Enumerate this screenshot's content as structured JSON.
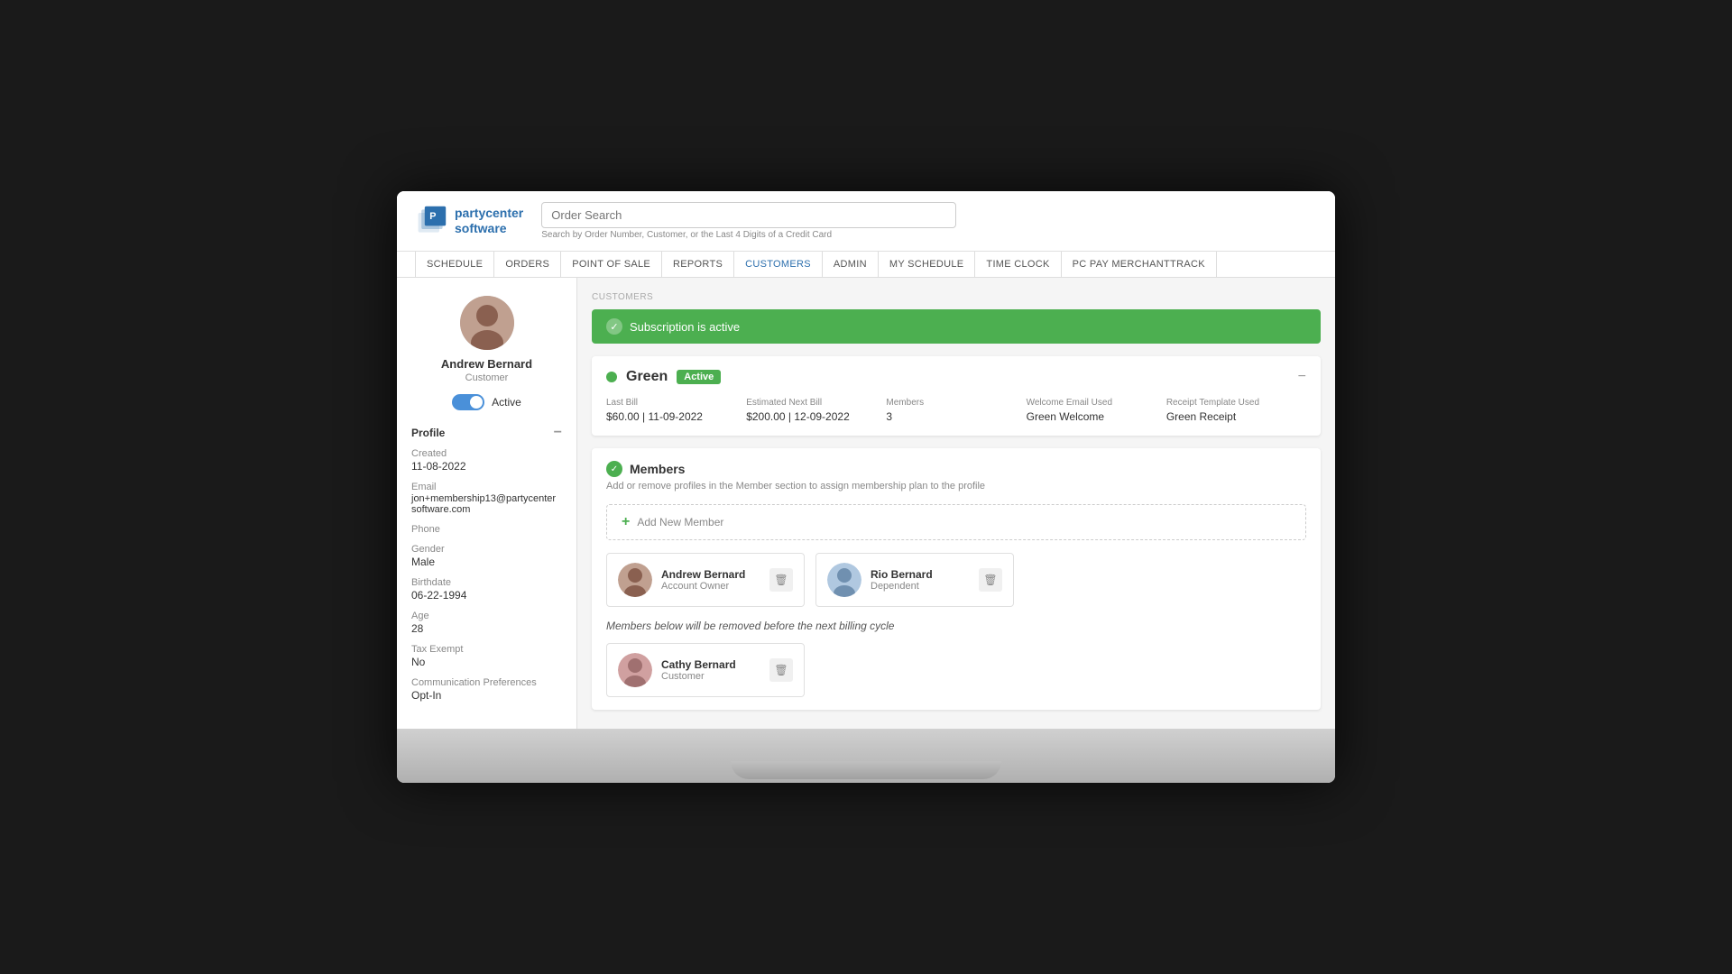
{
  "header": {
    "logo_line1": "partycenter",
    "logo_line2": "software",
    "search_placeholder": "Order Search",
    "search_hint": "Search by Order Number, Customer, or the Last 4 Digits of a Credit Card"
  },
  "nav": {
    "items": [
      {
        "label": "SCHEDULE",
        "active": false
      },
      {
        "label": "ORDERS",
        "active": false
      },
      {
        "label": "POINT OF SALE",
        "active": false
      },
      {
        "label": "REPORTS",
        "active": false
      },
      {
        "label": "CUSTOMERS",
        "active": true
      },
      {
        "label": "ADMIN",
        "active": false
      },
      {
        "label": "MY SCHEDULE",
        "active": false
      },
      {
        "label": "TIME CLOCK",
        "active": false
      },
      {
        "label": "PC PAY MERCHANTTRACK",
        "active": false
      }
    ]
  },
  "breadcrumb": "CUSTOMERS",
  "sidebar": {
    "user": {
      "name": "Andrew Bernard",
      "role": "Customer",
      "status": "Active"
    },
    "profile_section": "Profile",
    "fields": [
      {
        "label": "Created",
        "value": "11-08-2022"
      },
      {
        "label": "Email",
        "value": "jon+membership13@partycenter\nsoftware.com"
      },
      {
        "label": "Phone",
        "value": ""
      },
      {
        "label": "Gender",
        "value": "Male"
      },
      {
        "label": "Birthdate",
        "value": "06-22-1994"
      },
      {
        "label": "Age",
        "value": "28"
      },
      {
        "label": "Tax Exempt",
        "value": "No"
      },
      {
        "label": "Communication Preferences",
        "value": "Opt-In"
      }
    ]
  },
  "subscription_alert": "Subscription is active",
  "membership": {
    "name": "Green",
    "status": "Active",
    "stats": [
      {
        "label": "Last Bill",
        "value": "$60.00 | 11-09-2022"
      },
      {
        "label": "Estimated Next Bill",
        "value": "$200.00 | 12-09-2022"
      },
      {
        "label": "Members",
        "value": "3"
      },
      {
        "label": "Welcome Email Used",
        "value": "Green Welcome"
      },
      {
        "label": "Receipt Template Used",
        "value": "Green Receipt"
      }
    ]
  },
  "members_section": {
    "title": "Members",
    "hint": "Add or remove profiles in the Member section to assign membership plan to the profile",
    "add_button": "Add New Member",
    "members": [
      {
        "name": "Andrew Bernard",
        "type": "Account Owner"
      },
      {
        "name": "Rio Bernard",
        "type": "Dependent"
      }
    ],
    "removal_notice": "Members below will be removed before the next billing cycle",
    "removal_members": [
      {
        "name": "Cathy Bernard",
        "type": "Customer"
      }
    ]
  }
}
